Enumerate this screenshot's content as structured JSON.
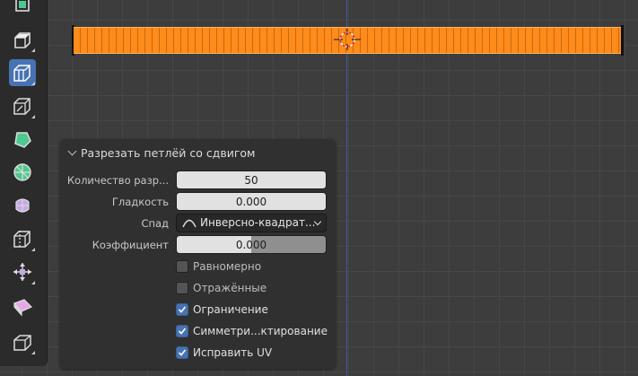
{
  "toolbar": {
    "tools": [
      {
        "icon": "cube-edge-icon",
        "active": false
      },
      {
        "icon": "extrude-region-icon",
        "active": false
      },
      {
        "icon": "inset-faces-icon",
        "active": false
      },
      {
        "icon": "bevel-icon",
        "active": false
      },
      {
        "icon": "poly-build-icon",
        "active": false
      },
      {
        "icon": "spin-icon",
        "active": false
      },
      {
        "icon": "smooth-vertices-icon",
        "active": false
      },
      {
        "icon": "loop-cut-icon",
        "active": true
      },
      {
        "icon": "knife-icon",
        "active": false
      },
      {
        "icon": "shrink-fatten-icon",
        "active": false
      },
      {
        "icon": "shear-icon",
        "active": false
      },
      {
        "icon": "rip-region-icon",
        "active": false
      }
    ]
  },
  "panel": {
    "title": "Разрезать петлёй со сдвигом",
    "cuts_label": "Количество разр...",
    "cuts_value": "50",
    "smoothness_label": "Гладкость",
    "smoothness_value": "0.000",
    "falloff_label": "Спад",
    "falloff_value": "Инверсно-квадрат...",
    "factor_label": "Коэффициент",
    "factor_value": "0.000",
    "even_label": "Равномерно",
    "even_checked": false,
    "flipped_label": "Отражённые",
    "flipped_checked": false,
    "clamp_label": "Ограничение",
    "clamp_checked": true,
    "mirror_label": "Симметри...ктирование",
    "mirror_checked": true,
    "correct_uv_label": "Исправить UV",
    "correct_uv_checked": true
  },
  "colors": {
    "accent": "#4772b3",
    "selection": "#ff8b1a",
    "panel_bg": "#303030",
    "viewport_bg": "#3d3d3d"
  }
}
